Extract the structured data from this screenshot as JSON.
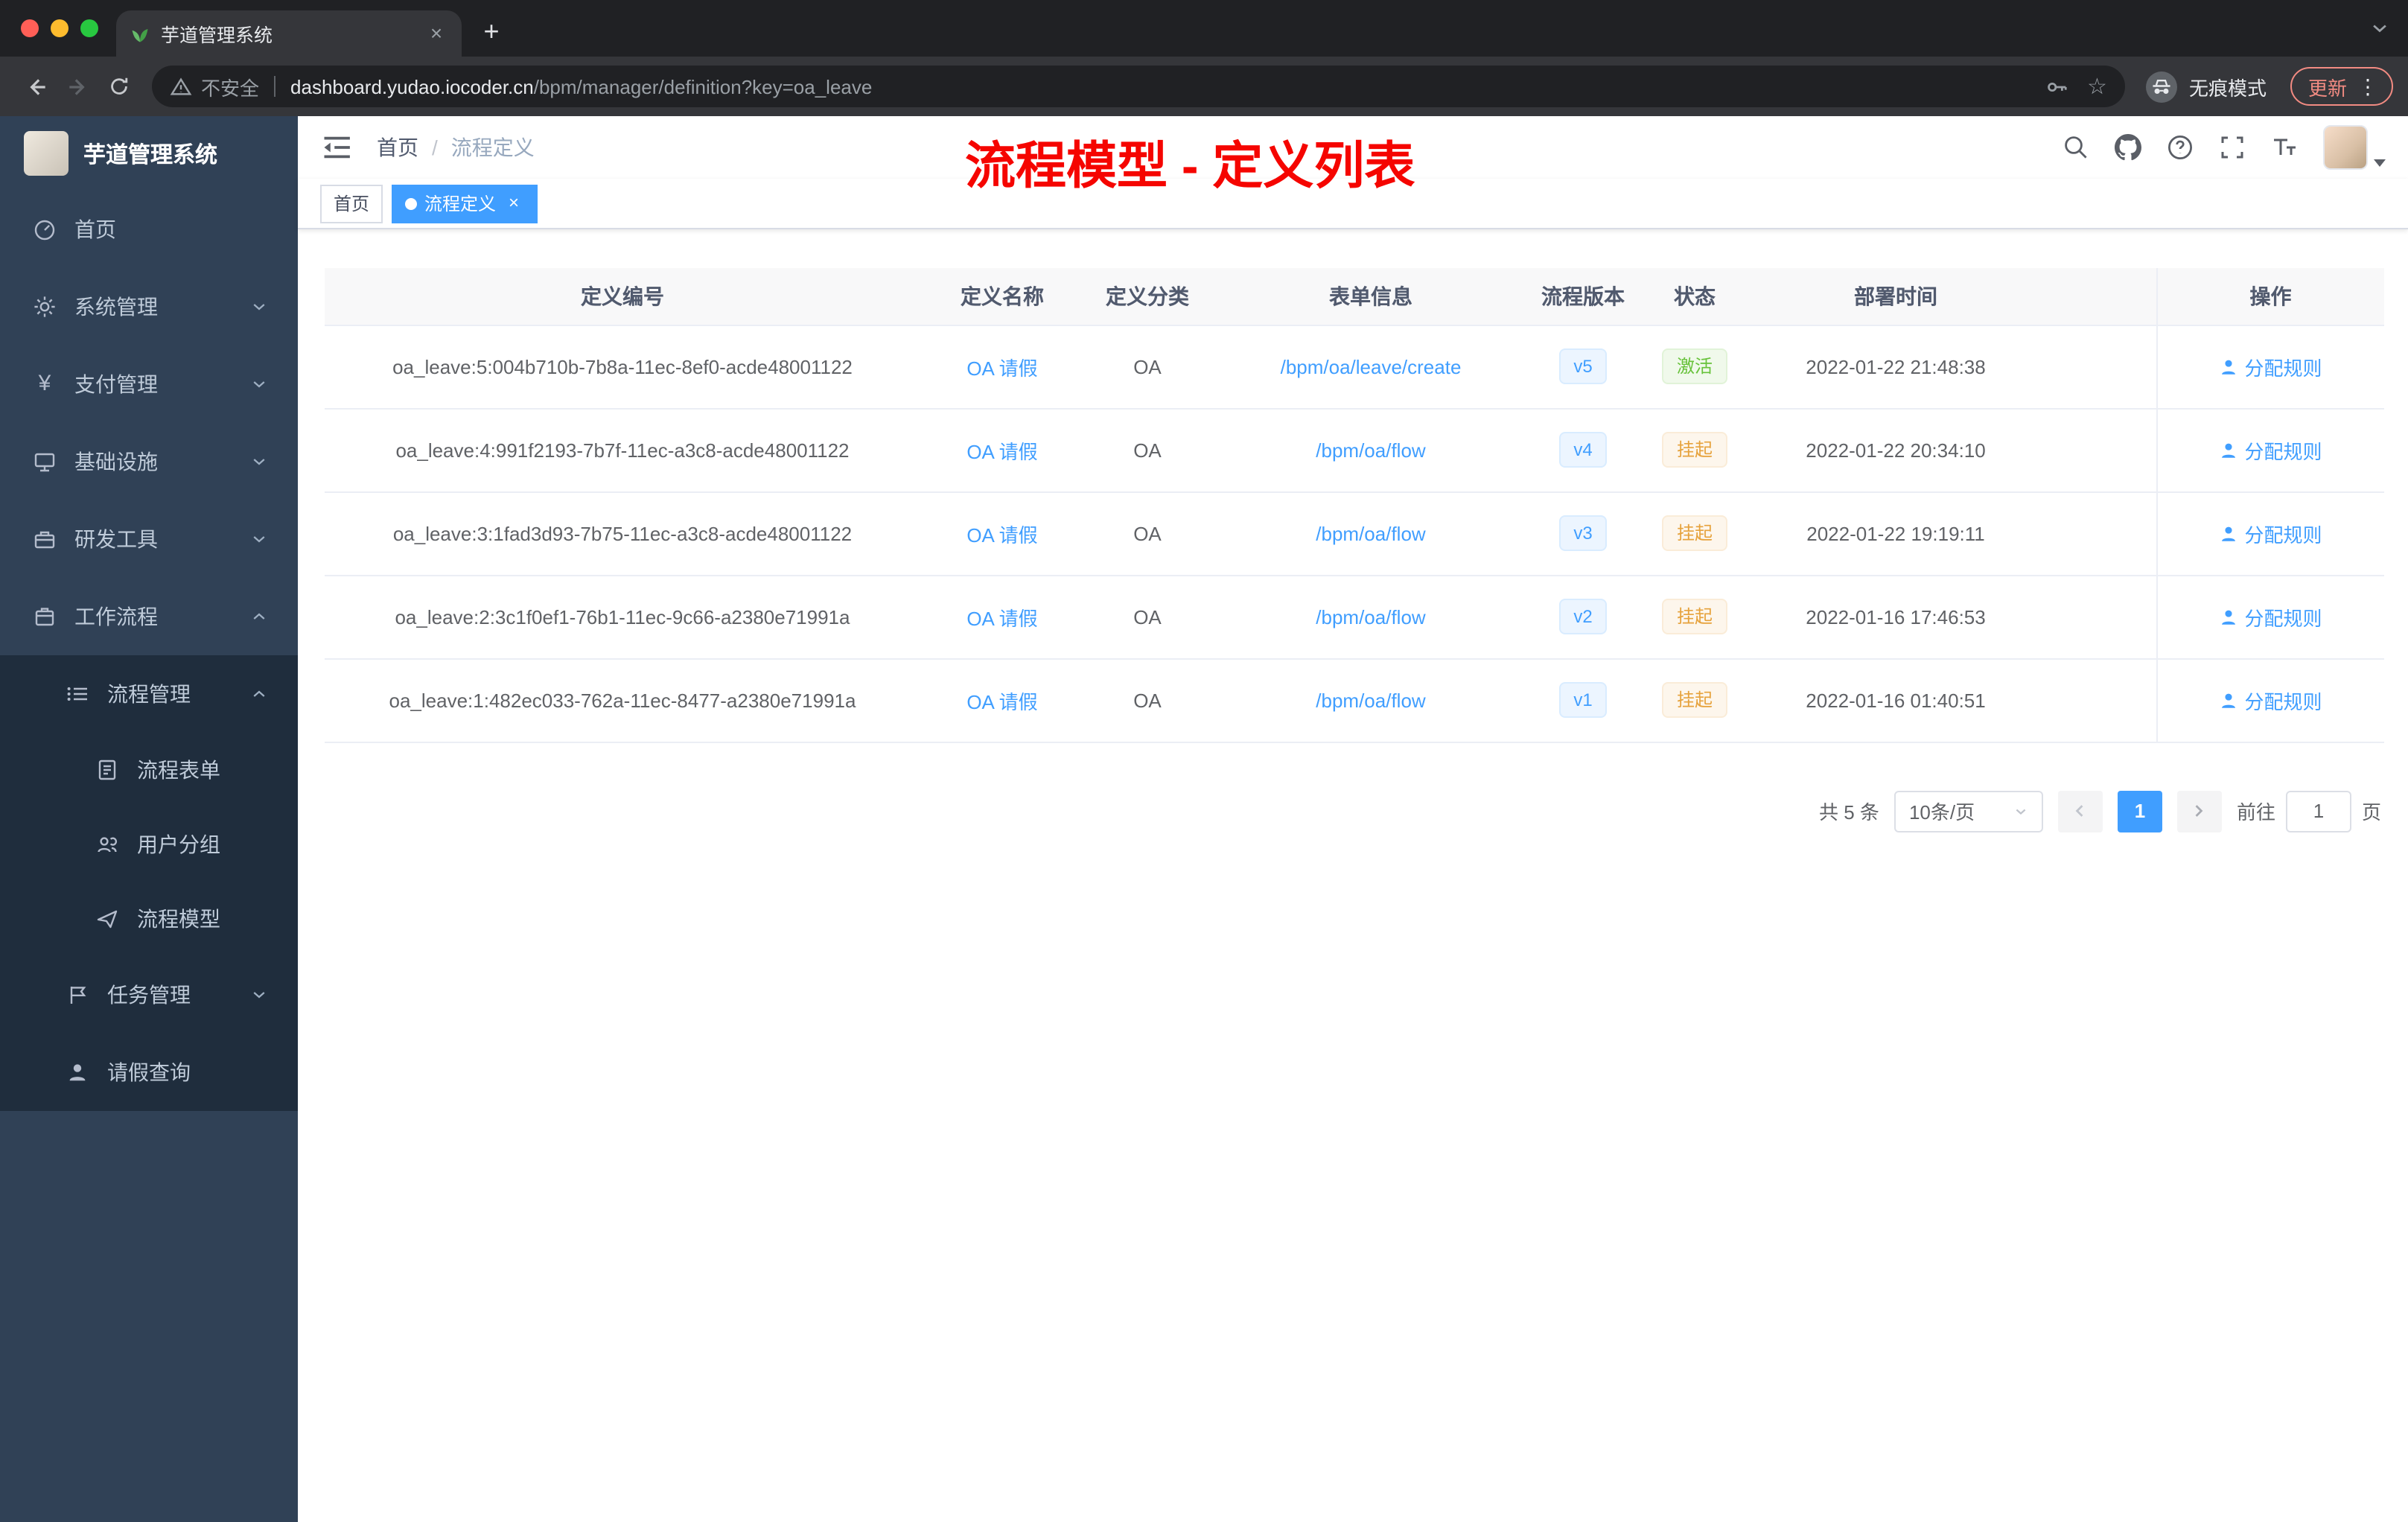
{
  "colors": {
    "accent": "#409eff",
    "annotation_red": "#f50500",
    "status_active_green": "#67c23a",
    "status_suspended_orange": "#e6a23c",
    "sidebar_bg": "#304156",
    "submenu_bg": "#1f2d3d",
    "update_chip": "#f28b82"
  },
  "browser": {
    "tab_title": "芋道管理系统",
    "security_label": "不安全",
    "url_host": "dashboard.yudao.iocoder.cn",
    "url_path": "/bpm/manager/definition?key=oa_leave",
    "incognito_label": "无痕模式",
    "update_label": "更新"
  },
  "icons": {
    "plus": "+",
    "close": "×",
    "dots": "⋮",
    "star": "☆",
    "yen": "¥"
  },
  "annotation_title": "流程模型 - 定义列表",
  "sidebar": {
    "logo_title": "芋道管理系统",
    "menu": [
      {
        "label": "首页"
      },
      {
        "label": "系统管理"
      },
      {
        "label": "支付管理"
      },
      {
        "label": "基础设施"
      },
      {
        "label": "研发工具"
      },
      {
        "label": "工作流程"
      },
      {
        "label": "流程管理"
      },
      {
        "label": "流程表单"
      },
      {
        "label": "用户分组"
      },
      {
        "label": "流程模型"
      },
      {
        "label": "任务管理"
      },
      {
        "label": "请假查询"
      }
    ]
  },
  "navbar": {
    "breadcrumb_home": "首页",
    "breadcrumb_sep": "/",
    "breadcrumb_current": "流程定义"
  },
  "tags": {
    "home": "首页",
    "active": "流程定义"
  },
  "table": {
    "columns": [
      "定义编号",
      "定义名称",
      "定义分类",
      "表单信息",
      "流程版本",
      "状态",
      "部署时间",
      "操作"
    ],
    "rows": [
      {
        "id": "oa_leave:5:004b710b-7b8a-11ec-8ef0-acde48001122",
        "name": "OA 请假",
        "category": "OA",
        "form": "/bpm/oa/leave/create",
        "version": "v5",
        "status": "激活",
        "status_type": "success",
        "time": "2022-01-22 21:48:38",
        "action": "分配规则"
      },
      {
        "id": "oa_leave:4:991f2193-7b7f-11ec-a3c8-acde48001122",
        "name": "OA 请假",
        "category": "OA",
        "form": "/bpm/oa/flow",
        "version": "v4",
        "status": "挂起",
        "status_type": "warning",
        "time": "2022-01-22 20:34:10",
        "action": "分配规则"
      },
      {
        "id": "oa_leave:3:1fad3d93-7b75-11ec-a3c8-acde48001122",
        "name": "OA 请假",
        "category": "OA",
        "form": "/bpm/oa/flow",
        "version": "v3",
        "status": "挂起",
        "status_type": "warning",
        "time": "2022-01-22 19:19:11",
        "action": "分配规则"
      },
      {
        "id": "oa_leave:2:3c1f0ef1-76b1-11ec-9c66-a2380e71991a",
        "name": "OA 请假",
        "category": "OA",
        "form": "/bpm/oa/flow",
        "version": "v2",
        "status": "挂起",
        "status_type": "warning",
        "time": "2022-01-16 17:46:53",
        "action": "分配规则"
      },
      {
        "id": "oa_leave:1:482ec033-762a-11ec-8477-a2380e71991a",
        "name": "OA 请假",
        "category": "OA",
        "form": "/bpm/oa/flow",
        "version": "v1",
        "status": "挂起",
        "status_type": "warning",
        "time": "2022-01-16 01:40:51",
        "action": "分配规则"
      }
    ]
  },
  "pagination": {
    "total": "共 5 条",
    "page_size": "10条/页",
    "current": "1",
    "goto_label": "前往",
    "goto_value": "1",
    "unit": "页"
  }
}
